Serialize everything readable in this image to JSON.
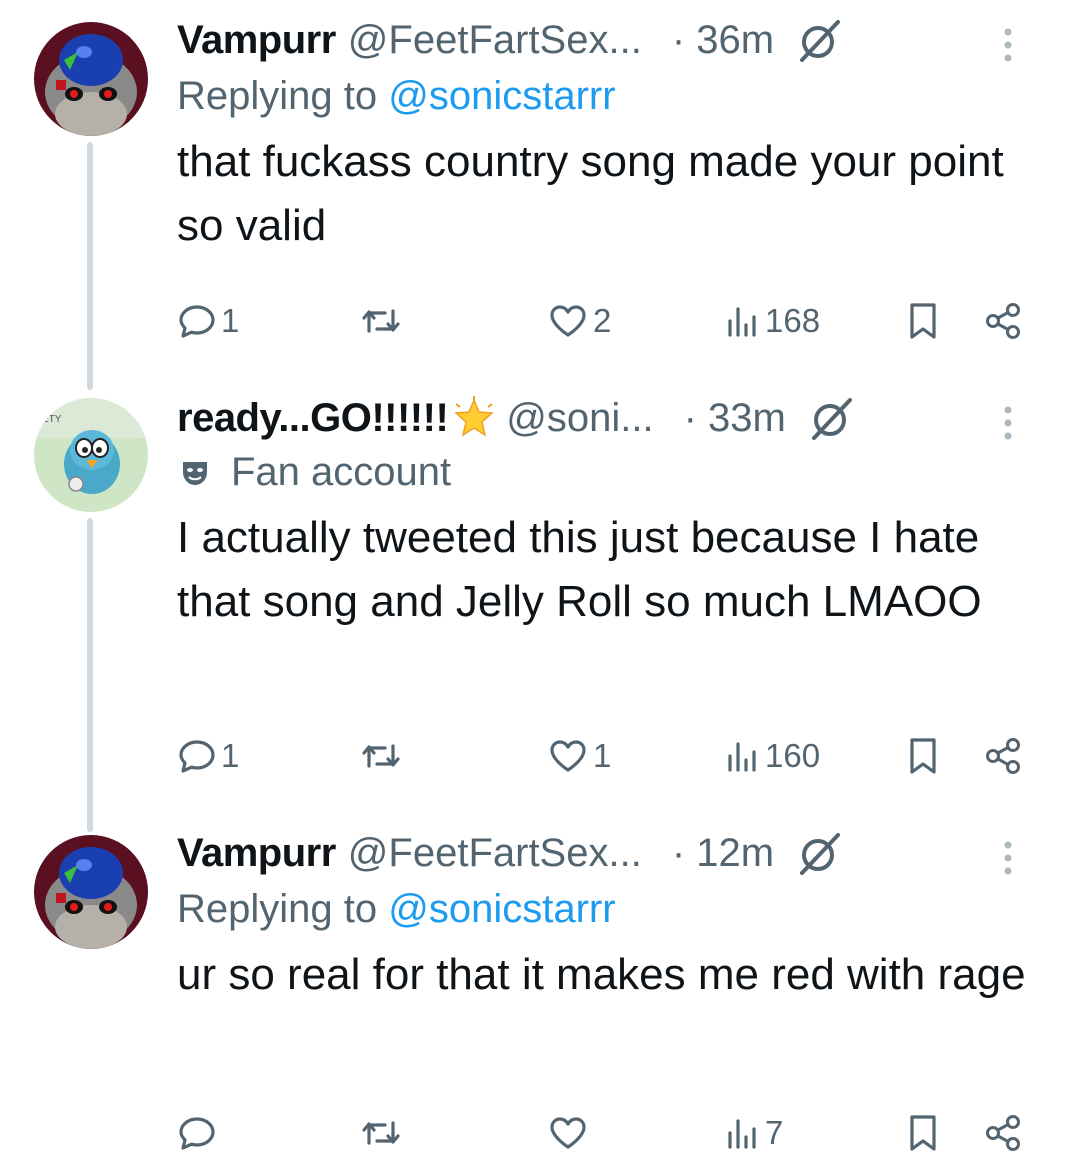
{
  "tweets": [
    {
      "display_name": "Vampurr",
      "handle": "@FeetFartSex...",
      "time": "· 36m",
      "replying_prefix": "Replying to ",
      "replying_to": "@sonicstarrr",
      "text": "that fuckass country song made your point so valid",
      "replies": "1",
      "retweets": "",
      "likes": "2",
      "views": "168"
    },
    {
      "display_name": "ready...GO!!!!!!",
      "handle": "@soni...",
      "time": "· 33m",
      "badge": "Fan account",
      "text": "I actually tweeted this just because I hate that song and Jelly Roll so much LMAOO",
      "replies": "1",
      "retweets": "",
      "likes": "1",
      "views": "160"
    },
    {
      "display_name": "Vampurr",
      "handle": "@FeetFartSex...",
      "time": "· 12m",
      "replying_prefix": "Replying to ",
      "replying_to": "@sonicstarrr",
      "text": "ur so real for that it makes me red with rage",
      "replies": "",
      "retweets": "",
      "likes": "",
      "views": "7"
    }
  ],
  "icons": {
    "reply": "reply-icon",
    "retweet": "retweet-icon",
    "like": "heart-icon",
    "views": "views-icon",
    "bookmark": "bookmark-icon",
    "share": "share-icon",
    "more": "more-vertical-icon",
    "grok": "grok-slash-icon",
    "emoji": "glowing-star-emoji"
  },
  "colors": {
    "text": "#0f1419",
    "secondary": "#536471",
    "link": "#1d9bf0",
    "thread_line": "#cfd9de"
  }
}
